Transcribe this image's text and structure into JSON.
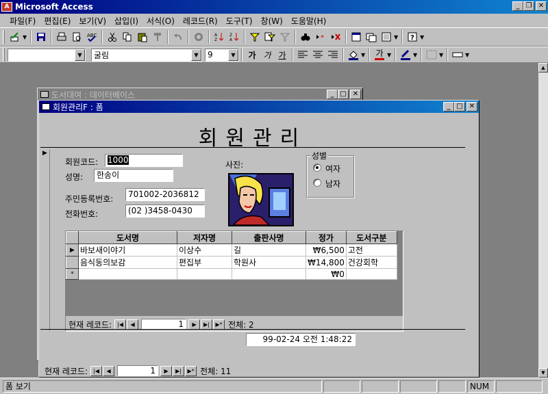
{
  "app": {
    "title": "Microsoft Access",
    "icon_label": "A"
  },
  "window_controls": {
    "minimize": "_",
    "restore": "❐",
    "close": "✕"
  },
  "menu": [
    {
      "label": "파일(F)"
    },
    {
      "label": "편집(E)"
    },
    {
      "label": "보기(V)"
    },
    {
      "label": "삽입(I)"
    },
    {
      "label": "서식(O)"
    },
    {
      "label": "레코드(R)"
    },
    {
      "label": "도구(T)"
    },
    {
      "label": "창(W)"
    },
    {
      "label": "도움말(H)"
    }
  ],
  "format_toolbar": {
    "object_combo": "",
    "font_combo": "굴림",
    "size_combo": "9",
    "bold": "가",
    "italic": "가",
    "underline": "가",
    "font_color_glyph": "가"
  },
  "db_window": {
    "title": "도서대여 : 데이터베이스"
  },
  "form_window": {
    "title": "회원관리F : 폼",
    "heading": "회원관리",
    "fields": {
      "member_code_label": "회원코드:",
      "member_code_value": "1000",
      "name_label": "성명:",
      "name_value": "한송이",
      "rrn_label": "주민등록번호:",
      "rrn_value": "701002-2036812",
      "phone_label": "전화번호:",
      "phone_value": "(02 )3458-0430",
      "photo_label": "사진:"
    },
    "gender": {
      "title": "성별",
      "options": [
        {
          "label": "여자",
          "selected": true
        },
        {
          "label": "남자",
          "selected": false
        }
      ]
    },
    "subform": {
      "columns": [
        "도서명",
        "저자명",
        "출판사명",
        "정가",
        "도서구분"
      ],
      "rows": [
        {
          "marker": "▶",
          "title": "바보새이야기",
          "author": "이상수",
          "publisher": "길",
          "price": "₩6,500",
          "category": "고전"
        },
        {
          "marker": "",
          "title": "음식동의보감",
          "author": "편집부",
          "publisher": "학원사",
          "price": "₩14,800",
          "category": "건강회학"
        },
        {
          "marker": "*",
          "title": "",
          "author": "",
          "publisher": "",
          "price": "₩0",
          "category": ""
        }
      ],
      "nav": {
        "label": "현재 레코드:",
        "current": "1",
        "total_label": "전체: 2"
      }
    },
    "timestamp": "99-02-24 오전 1:48:22",
    "nav": {
      "label": "현재 레코드:",
      "current": "1",
      "total_label": "전체: 11"
    }
  },
  "statusbar": {
    "mode": "폼 보기",
    "num": "NUM"
  }
}
